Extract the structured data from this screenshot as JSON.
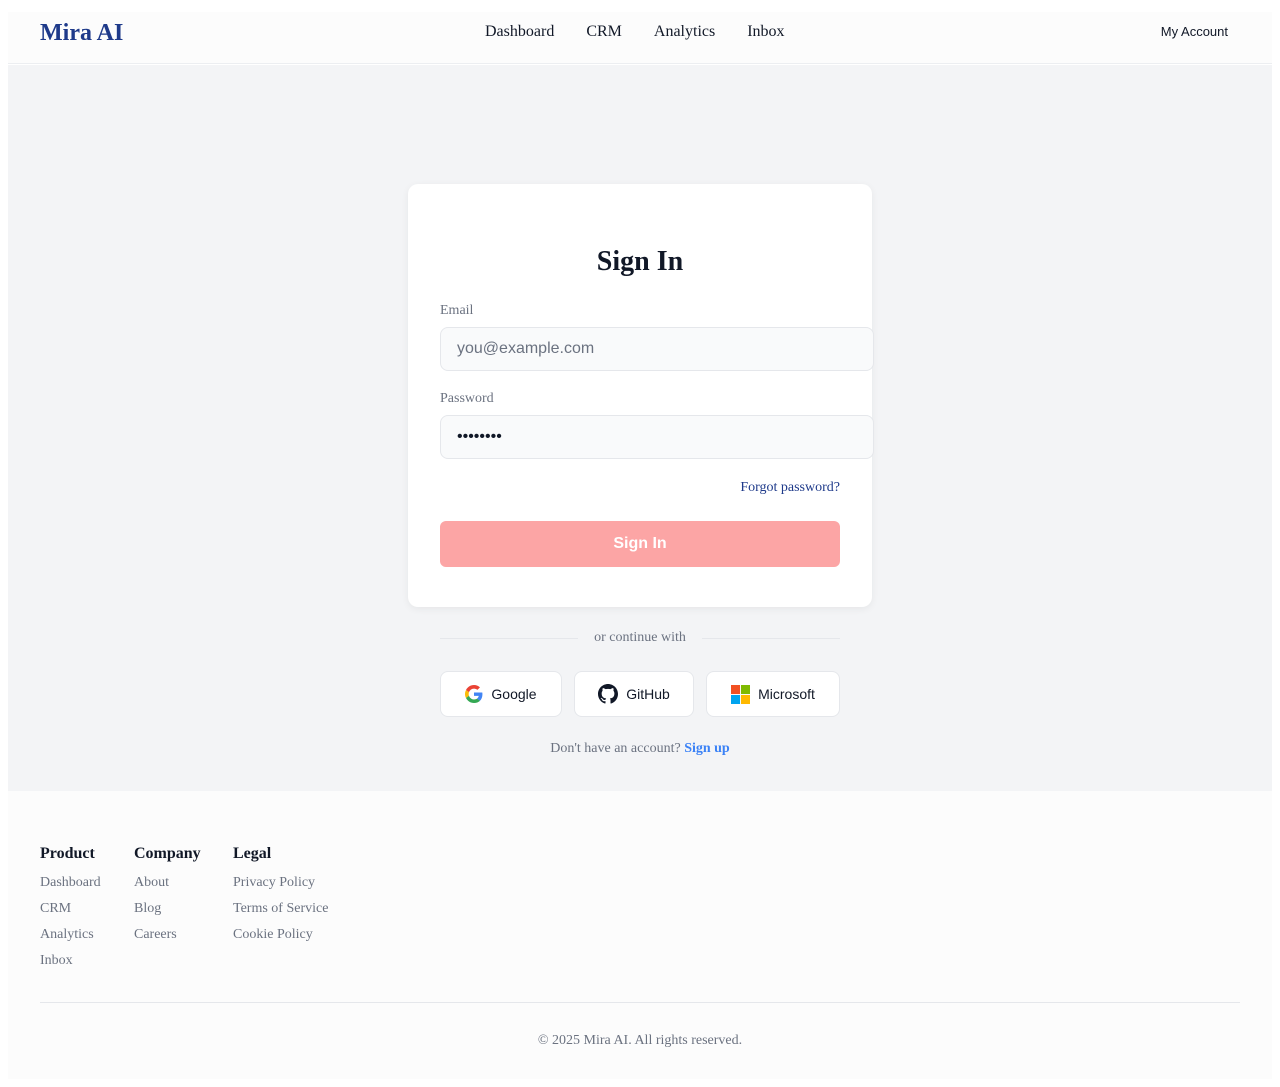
{
  "header": {
    "brand": "Mira AI",
    "nav": [
      "Dashboard",
      "CRM",
      "Analytics",
      "Inbox"
    ],
    "account": "My Account"
  },
  "signin": {
    "title": "Sign In",
    "email_label": "Email",
    "email_placeholder": "you@example.com",
    "password_label": "Password",
    "password_value": "••••••••",
    "forgot": "Forgot password?",
    "submit": "Sign In",
    "divider": "or continue with",
    "social": [
      {
        "label": "Google",
        "icon": "google-icon"
      },
      {
        "label": "GitHub",
        "icon": "github-icon"
      },
      {
        "label": "Microsoft",
        "icon": "microsoft-icon"
      }
    ],
    "no_account": "Don't have an account?",
    "signup": "Sign up"
  },
  "colors": {
    "brand": "#1e3a8a",
    "submit_bg": "#fca5a5",
    "signup_link": "#3b82f6"
  },
  "footer": {
    "columns": [
      {
        "title": "Product",
        "links": [
          "Dashboard",
          "CRM",
          "Analytics",
          "Inbox"
        ]
      },
      {
        "title": "Company",
        "links": [
          "About",
          "Blog",
          "Careers"
        ]
      },
      {
        "title": "Legal",
        "links": [
          "Privacy Policy",
          "Terms of Service",
          "Cookie Policy"
        ]
      }
    ],
    "copyright": "© 2025 Mira AI. All rights reserved."
  }
}
